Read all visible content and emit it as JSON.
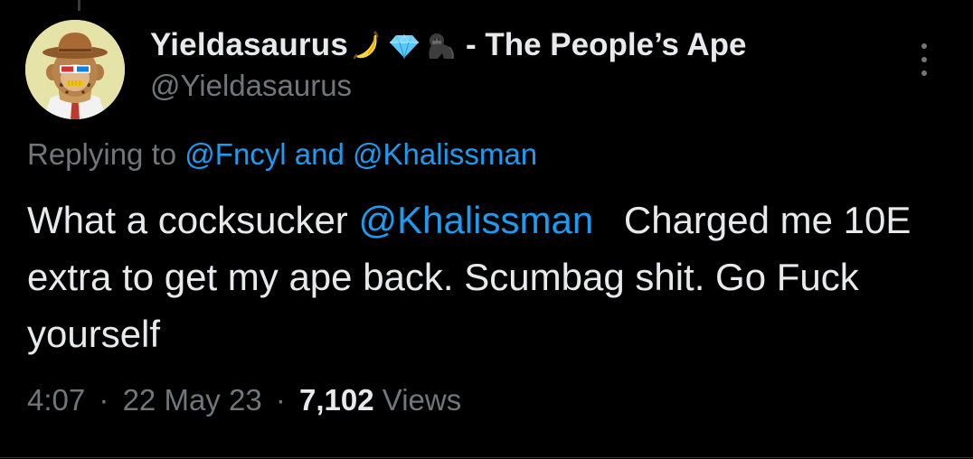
{
  "tweet": {
    "display_name": "Yieldasaurus",
    "name_emojis": [
      "banana-emoji",
      "diamond-emoji",
      "gorilla-emoji"
    ],
    "name_suffix": "- The People’s Ape",
    "handle": "@Yieldasaurus",
    "replying_prefix": "Replying to",
    "replying_to": [
      "@Fncyl",
      "@Khalissman"
    ],
    "replying_joiner": "and",
    "body_prefix": "What a cocksucker",
    "body_mention": "@Khalissman",
    "body_text": "Charged me 10E extra to get my ape back. Scumbag shit. Go Fuck yourself",
    "time": "4:07",
    "separator": "·",
    "date": "22 May 23",
    "views_count": "7,102",
    "views_label": "Views"
  },
  "colors": {
    "background": "#000000",
    "primary_text": "#e7e9ea",
    "secondary_text": "#71767b",
    "link": "#1d9bf0"
  },
  "icons": {
    "more": "more-vertical-icon"
  }
}
